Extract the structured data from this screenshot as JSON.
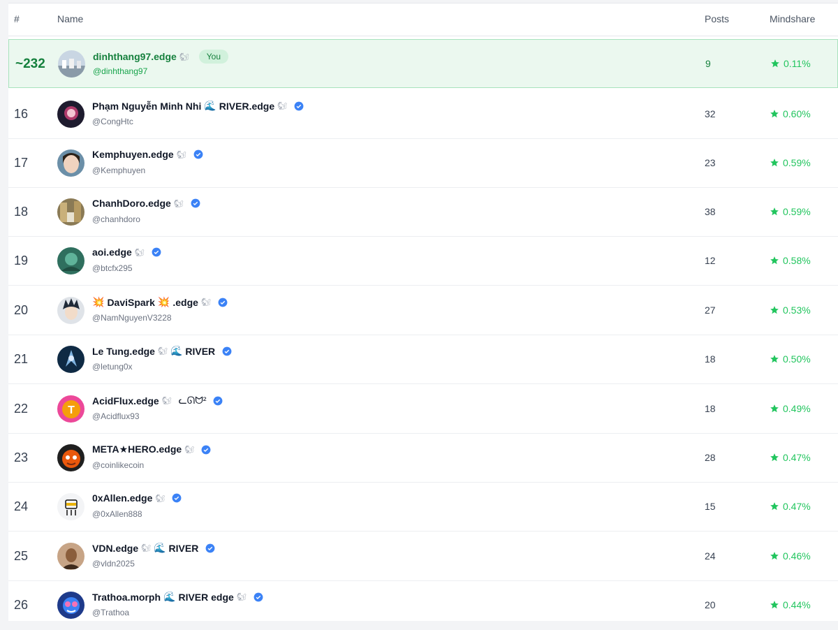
{
  "header": {
    "rank": "#",
    "name": "Name",
    "posts": "Posts",
    "mindshare": "Mindshare"
  },
  "you_badge": "You",
  "colors": {
    "accent_green": "#22c55e",
    "you_bg": "#ebf8ef",
    "verified_blue": "#3b82f6"
  },
  "rows": [
    {
      "rank": "~232",
      "name": "dinhthang97.edge",
      "handle": "@dinhthang97",
      "posts": "9",
      "mindshare": "0.11%",
      "you": true
    },
    {
      "rank": "16",
      "name": "Phạm Nguyễn Minh Nhi",
      "name_extra": "RIVER.edge",
      "handle": "@CongHtc",
      "posts": "32",
      "mindshare": "0.60%"
    },
    {
      "rank": "17",
      "name": "Kemphuyen.edge",
      "handle": "@Kemphuyen",
      "posts": "23",
      "mindshare": "0.59%"
    },
    {
      "rank": "18",
      "name": "ChanhDoro.edge",
      "handle": "@chanhdoro",
      "posts": "38",
      "mindshare": "0.59%"
    },
    {
      "rank": "19",
      "name": "aoi.edge",
      "handle": "@btcfx295",
      "posts": "12",
      "mindshare": "0.58%"
    },
    {
      "rank": "20",
      "name": "DaviSpark",
      "name_extra": ".edge",
      "handle": "@NamNguyenV3228",
      "posts": "27",
      "mindshare": "0.53%"
    },
    {
      "rank": "21",
      "name": "Le Tung.edge",
      "name_extra": "RIVER",
      "handle": "@letung0x",
      "posts": "18",
      "mindshare": "0.50%"
    },
    {
      "rank": "22",
      "name": "AcidFlux.edge",
      "name_extra": "ᓚᘏᗢ²",
      "handle": "@Acidflux93",
      "posts": "18",
      "mindshare": "0.49%"
    },
    {
      "rank": "23",
      "name": "META★HERO.edge",
      "handle": "@coinlikecoin",
      "posts": "28",
      "mindshare": "0.47%"
    },
    {
      "rank": "24",
      "name": "0xAllen.edge",
      "handle": "@0xAllen888",
      "posts": "15",
      "mindshare": "0.47%"
    },
    {
      "rank": "25",
      "name": "VDN.edge",
      "name_extra": "RIVER",
      "handle": "@vldn2025",
      "posts": "24",
      "mindshare": "0.46%"
    },
    {
      "rank": "26",
      "name": "Trathoa.morph",
      "name_extra": "RIVER edge",
      "handle": "@Trathoa",
      "posts": "20",
      "mindshare": "0.44%"
    }
  ]
}
